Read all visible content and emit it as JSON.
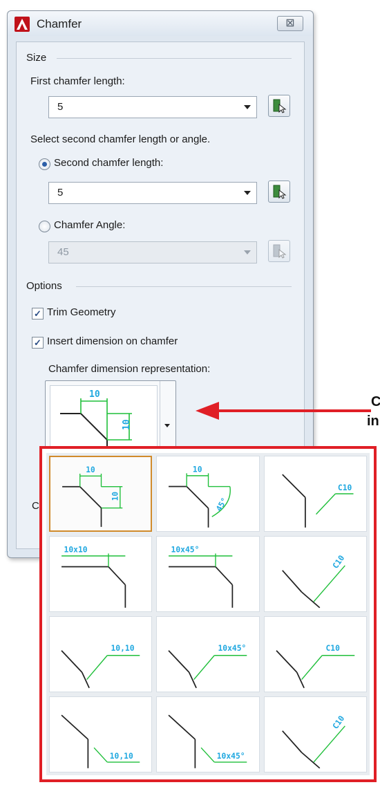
{
  "window": {
    "title": "Chamfer",
    "close_glyph": "⊠"
  },
  "size_section": {
    "heading": "Size",
    "first_length_label": "First chamfer length:",
    "first_length_value": "5",
    "prompt": "Select second chamfer length or angle.",
    "second_length_label": "Second chamfer length:",
    "second_length_value": "5",
    "angle_label": "Chamfer Angle:",
    "angle_value": "45",
    "second_length_selected": true
  },
  "options_section": {
    "heading": "Options",
    "trim_label": "Trim Geometry",
    "trim_checked": true,
    "insert_dim_label": "Insert dimension on chamfer",
    "insert_dim_checked": true,
    "repr_label": "Chamfer dimension representation:",
    "check_glyph": "✓"
  },
  "hidden_label_fragment": "C",
  "side_text": [
    "C",
    "in"
  ],
  "gallery": {
    "selected_index": 0,
    "items": [
      {
        "style": "linear-both",
        "texts": [
          "10",
          "10"
        ]
      },
      {
        "style": "linear-angle",
        "texts": [
          "10",
          "45°"
        ]
      },
      {
        "style": "leader-c",
        "texts": [
          "C10"
        ]
      },
      {
        "style": "dim-size",
        "texts": [
          "10x10"
        ]
      },
      {
        "style": "dim-size",
        "texts": [
          "10x45°"
        ]
      },
      {
        "style": "leader-slant",
        "texts": [
          "C10"
        ]
      },
      {
        "style": "leader-text",
        "texts": [
          "10,10"
        ]
      },
      {
        "style": "leader-text",
        "texts": [
          "10x45°"
        ]
      },
      {
        "style": "leader-text",
        "texts": [
          "C10"
        ]
      },
      {
        "style": "underline-leader",
        "texts": [
          "10,10"
        ]
      },
      {
        "style": "underline-leader",
        "texts": [
          "10x45°"
        ]
      },
      {
        "style": "leader-slant",
        "texts": [
          "C10"
        ]
      }
    ]
  },
  "colors": {
    "dim_line": "#1fbf3a",
    "dim_text": "#20a8e0",
    "highlight": "#e01f26",
    "selection": "#d18b2c"
  }
}
